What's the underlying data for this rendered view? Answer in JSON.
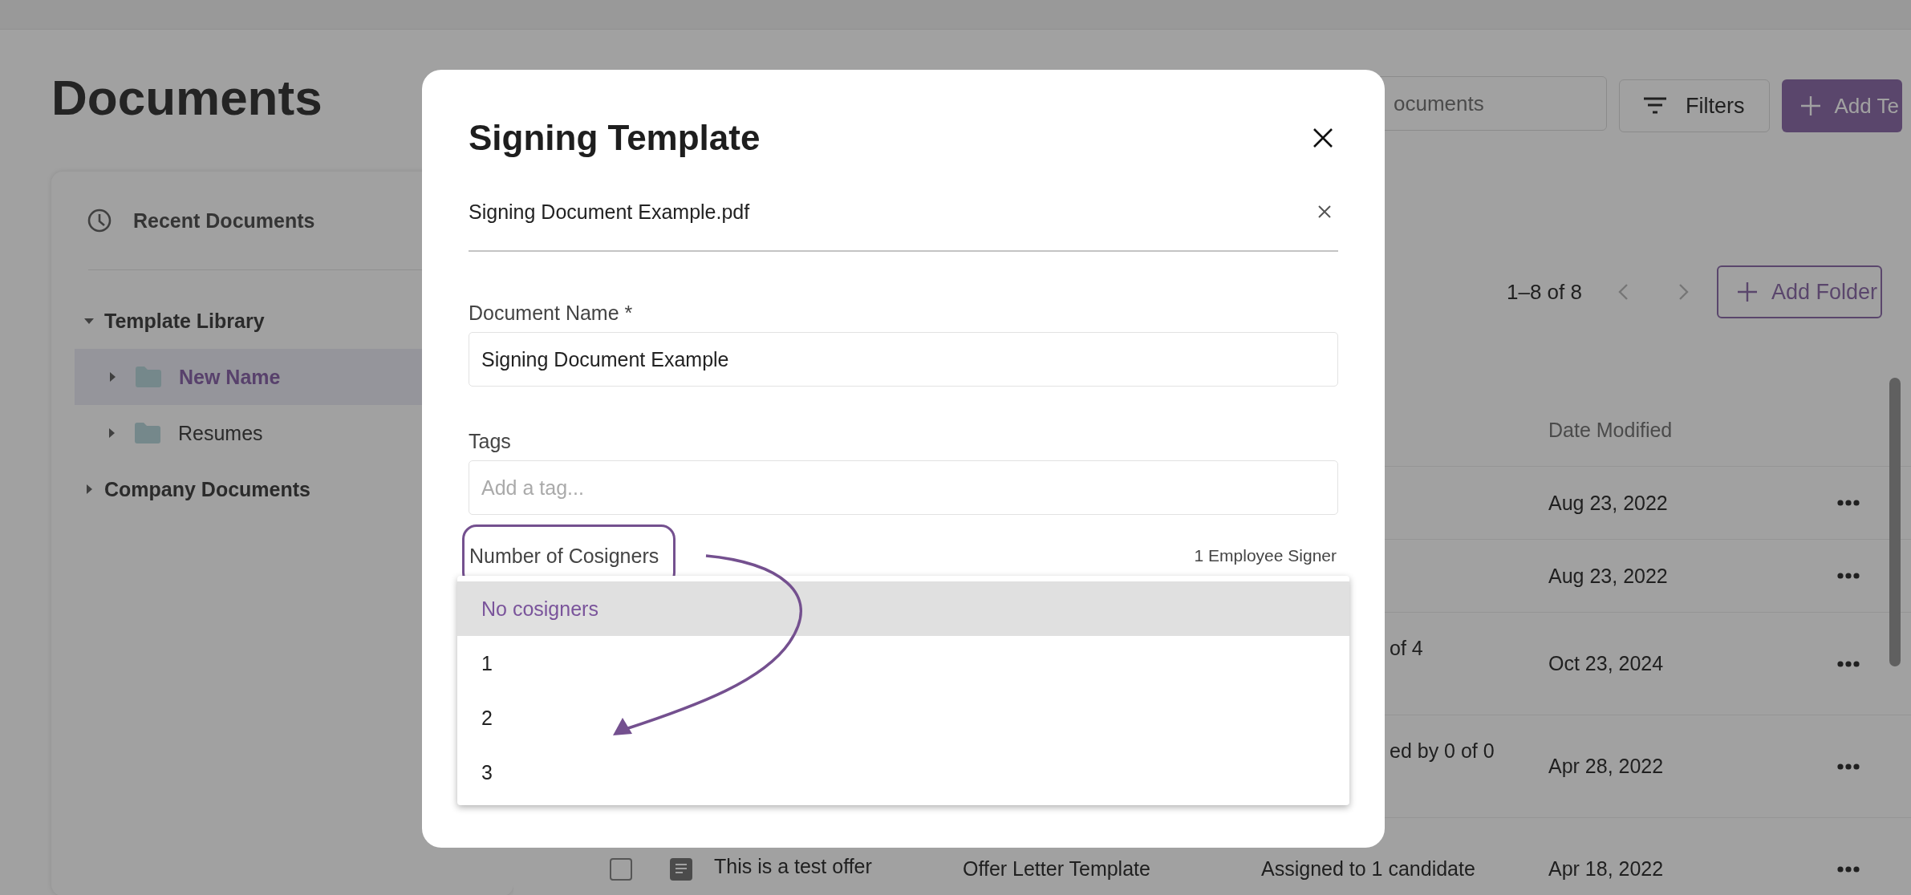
{
  "page": {
    "title": "Documents"
  },
  "toolbar": {
    "search": {
      "placeholder": "ocuments"
    },
    "buttons": [
      {
        "kind": "secondary",
        "label": "Filters"
      },
      {
        "kind": "primary",
        "label": "Add Te"
      }
    ]
  },
  "sidebar": {
    "recent": {
      "label": "Recent Documents"
    },
    "tree": [
      {
        "label": "Template Library",
        "selected": false,
        "expanded": true,
        "children": [
          {
            "label": "New Name",
            "selected": true,
            "expanded": false
          },
          {
            "label": "Resumes",
            "selected": false,
            "expanded": false
          }
        ]
      },
      {
        "label": "Company Documents",
        "selected": false,
        "expanded": false
      }
    ]
  },
  "pagination": {
    "range": "1–8 of 8",
    "add_button": "Add Folder"
  },
  "table": {
    "columns": [
      {
        "label": "Date Modified"
      }
    ],
    "rows": [
      {
        "kind": "covered",
        "date": "Aug 23, 2022"
      },
      {
        "kind": "covered",
        "date": "Aug 23, 2022"
      },
      {
        "kind": "covered",
        "status": "of 4",
        "date": "Oct 23, 2024"
      },
      {
        "kind": "covered",
        "status": "ed by 0 of 0",
        "date": "Apr 28, 2022"
      },
      {
        "kind": "full",
        "checked": false,
        "name": "This is a test offer",
        "type": "Offer Letter Template",
        "status": "Assigned to 1 candidate",
        "date": "Apr 18, 2022"
      }
    ]
  },
  "modal": {
    "title": "Signing Template",
    "file": "Signing Document Example.pdf",
    "fields": [
      {
        "label": "Document Name *",
        "value": "Signing Document Example"
      },
      {
        "label": "Tags",
        "placeholder": "Add a tag..."
      }
    ],
    "cosigners": {
      "label": "Number of Cosigners",
      "highlighted": true,
      "hint": "1 Employee Signer",
      "options": [
        {
          "label": "No cosigners",
          "selected": true
        },
        {
          "label": "1",
          "selected": false
        },
        {
          "label": "2",
          "selected": false
        },
        {
          "label": "3",
          "selected": false
        }
      ]
    }
  }
}
